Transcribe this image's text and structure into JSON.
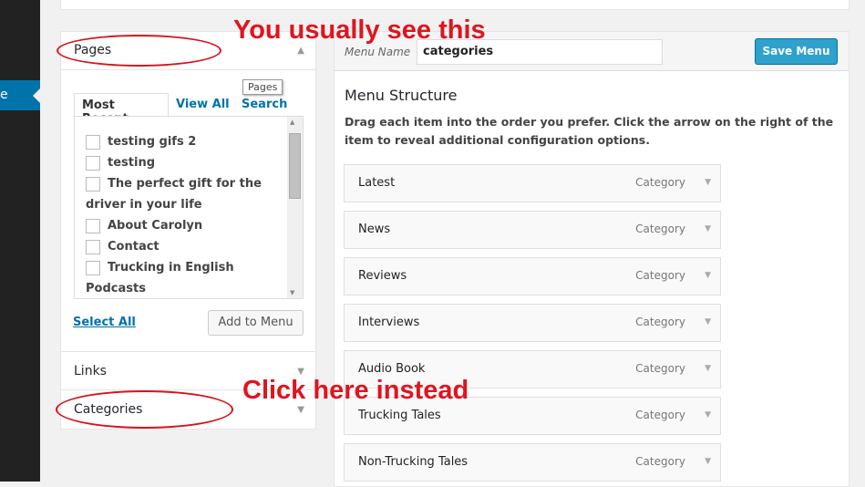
{
  "sidebar": {
    "active_label": "e"
  },
  "pages_box": {
    "title": "Pages",
    "tooltip": "Pages",
    "tabs": [
      "Most Recent",
      "View All",
      "Search"
    ],
    "items": [
      "testing gifs 2",
      "testing",
      "The perfect gift for the",
      "driver in your life",
      "About Carolyn",
      "Contact",
      "Trucking in English",
      "Podcasts"
    ],
    "select_all": "Select All",
    "add_button": "Add to Menu"
  },
  "links_box": {
    "title": "Links"
  },
  "categories_box": {
    "title": "Categories"
  },
  "menu": {
    "name_label": "Menu Name",
    "name_value": "categories",
    "save_label": "Save Menu",
    "structure_title": "Menu Structure",
    "instructions": "Drag each item into the order you prefer. Click the arrow on the right of the item to reveal additional configuration options.",
    "items": [
      {
        "title": "Latest",
        "type": "Category"
      },
      {
        "title": "News",
        "type": "Category"
      },
      {
        "title": "Reviews",
        "type": "Category"
      },
      {
        "title": "Interviews",
        "type": "Category"
      },
      {
        "title": "Audio Book",
        "type": "Category"
      },
      {
        "title": "Trucking Tales",
        "type": "Category"
      },
      {
        "title": "Non-Trucking Tales",
        "type": "Category"
      }
    ]
  },
  "annotations": {
    "top": "You usually see this",
    "bottom": "Click here instead"
  }
}
